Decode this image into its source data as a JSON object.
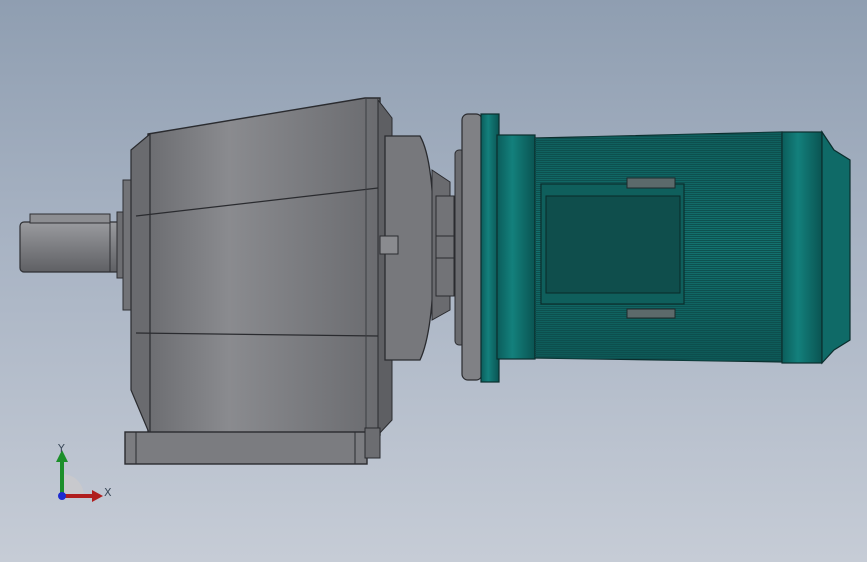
{
  "triad": {
    "x_label": "X",
    "y_label": "Y"
  },
  "colors": {
    "background_top": "#8f9eb1",
    "background_bottom": "#c6ccd6",
    "gearbox": "#7f8084",
    "motor": "#0f6e6c",
    "x_axis": "#b01e1e",
    "y_axis": "#1c8f2a",
    "z_axis": "#1d2bd0"
  },
  "icons": [
    "coordinate-triad-icon"
  ]
}
